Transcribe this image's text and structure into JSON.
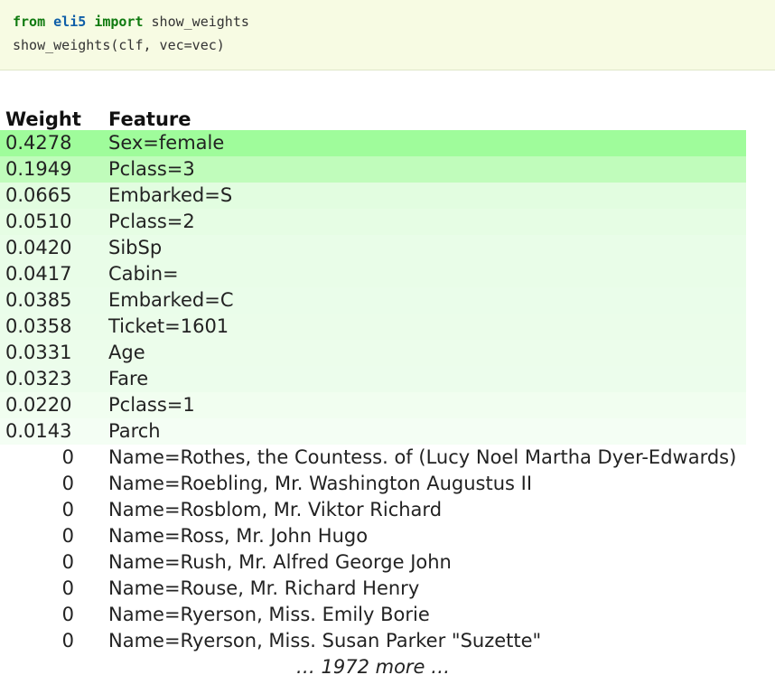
{
  "code": {
    "line1": {
      "kw_from": "from",
      "module": "eli5",
      "kw_import": "import",
      "name": "show_weights"
    },
    "line2": "show_weights(clf, vec=vec)"
  },
  "table": {
    "headers": [
      "Weight",
      "Feature"
    ],
    "rows": [
      {
        "weight": "0.4278",
        "feature": "Sex=female",
        "color": "#9ffc9b"
      },
      {
        "weight": "0.1949",
        "feature": "Pclass=3",
        "color": "#c0fcbb"
      },
      {
        "weight": "0.0665",
        "feature": "Embarked=S",
        "color": "#e2fde0"
      },
      {
        "weight": "0.0510",
        "feature": "Pclass=2",
        "color": "#e6fde4"
      },
      {
        "weight": "0.0420",
        "feature": "SibSp",
        "color": "#e9fde8"
      },
      {
        "weight": "0.0417",
        "feature": "Cabin=",
        "color": "#e9fde8"
      },
      {
        "weight": "0.0385",
        "feature": "Embarked=C",
        "color": "#eafdea"
      },
      {
        "weight": "0.0358",
        "feature": "Ticket=1601",
        "color": "#ebfdea"
      },
      {
        "weight": "0.0331",
        "feature": "Age",
        "color": "#ecfdeb"
      },
      {
        "weight": "0.0323",
        "feature": "Fare",
        "color": "#ecfdec"
      },
      {
        "weight": "0.0220",
        "feature": "Pclass=1",
        "color": "#f1fef0"
      },
      {
        "weight": "0.0143",
        "feature": "Parch",
        "color": "#f4fef4"
      },
      {
        "weight": "0",
        "feature": "Name=Rothes, the Countess. of (Lucy Noel Martha Dyer-Edwards)",
        "color": "#ffffff"
      },
      {
        "weight": "0",
        "feature": "Name=Roebling, Mr. Washington Augustus II",
        "color": "#ffffff"
      },
      {
        "weight": "0",
        "feature": "Name=Rosblom, Mr. Viktor Richard",
        "color": "#ffffff"
      },
      {
        "weight": "0",
        "feature": "Name=Ross, Mr. John Hugo",
        "color": "#ffffff"
      },
      {
        "weight": "0",
        "feature": "Name=Rush, Mr. Alfred George John",
        "color": "#ffffff"
      },
      {
        "weight": "0",
        "feature": "Name=Rouse, Mr. Richard Henry",
        "color": "#ffffff"
      },
      {
        "weight": "0",
        "feature": "Name=Ryerson, Miss. Emily Borie",
        "color": "#ffffff"
      },
      {
        "weight": "0",
        "feature": "Name=Ryerson, Miss. Susan Parker \"Suzette\"",
        "color": "#ffffff"
      }
    ],
    "more_text": "… 1972 more …"
  }
}
